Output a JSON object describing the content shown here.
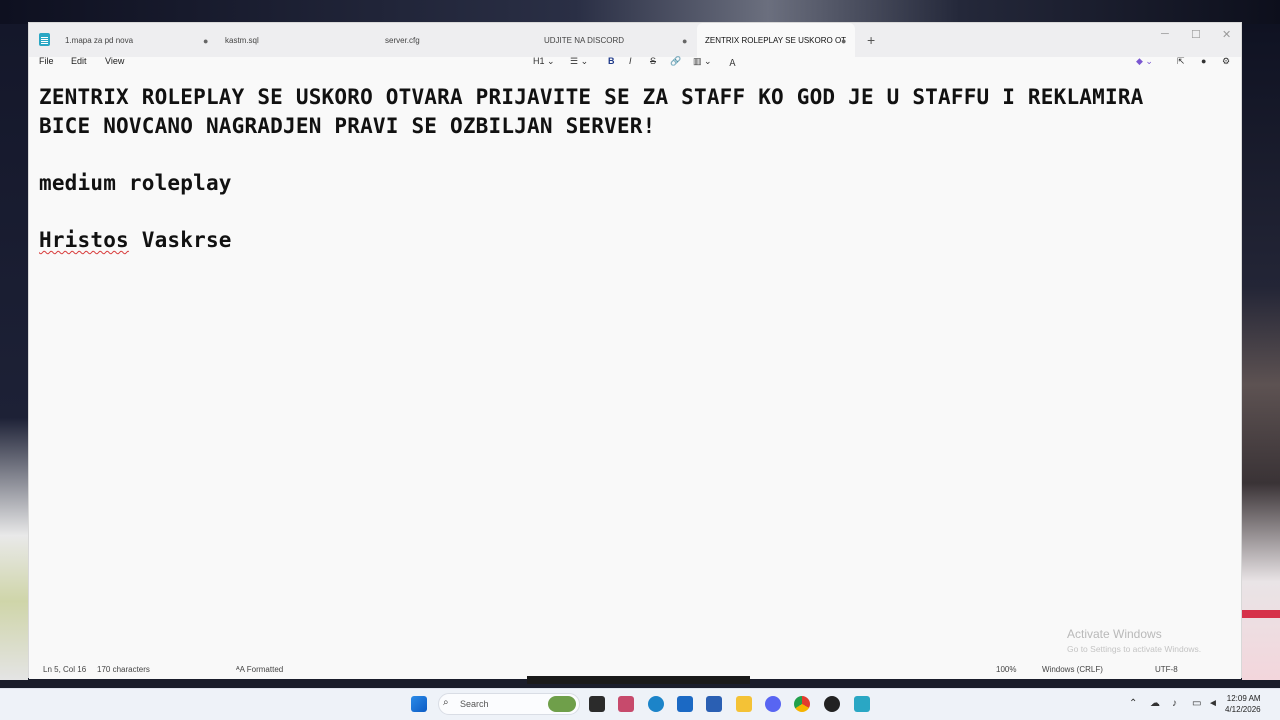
{
  "tabs": [
    {
      "label": "1.mapa za pd nova",
      "modified": true
    },
    {
      "label": "kastm.sql",
      "modified": false
    },
    {
      "label": "server.cfg",
      "modified": false
    },
    {
      "label": "UDJITE NA DISCORD",
      "modified": true
    },
    {
      "label": "ZENTRIX ROLEPLAY SE USKORO OT",
      "modified": true
    }
  ],
  "menu": {
    "file": "File",
    "edit": "Edit",
    "view": "View"
  },
  "toolbar": {
    "heading": "H1",
    "bold": "B",
    "italic": "I",
    "strike": "S"
  },
  "document": {
    "line1": "ZENTRIX ROLEPLAY SE USKORO OTVARA PRIJAVITE SE ZA STAFF KO GOD JE U STAFFU I REKLAMIRA",
    "line2": "BICE NOVCANO NAGRADJEN PRAVI SE OZBILJAN SERVER!",
    "line3": "medium roleplay",
    "line4_word1": "Hristos",
    "line4_word2": "Vaskrse"
  },
  "status": {
    "position": "Ln 5, Col 16",
    "chars": "170 characters",
    "format": "Formatted",
    "zoom": "100%",
    "line_ending": "Windows (CRLF)",
    "encoding": "UTF-8"
  },
  "watermark": {
    "title": "Activate Windows",
    "subtitle": "Go to Settings to activate Windows."
  },
  "taskbar": {
    "search": "Search",
    "time": "12:09 AM",
    "date": "4/12/2026"
  },
  "colors": {
    "accent": "#1f3a8a",
    "spellcheck": "#d83a3a"
  },
  "icons": [
    "notepad-icon",
    "start-icon",
    "search-icon",
    "edge-icon",
    "outlook-icon",
    "store-icon",
    "explorer-icon",
    "discord-icon",
    "chrome-icon",
    "steam-icon",
    "notepad-taskbar-icon"
  ]
}
